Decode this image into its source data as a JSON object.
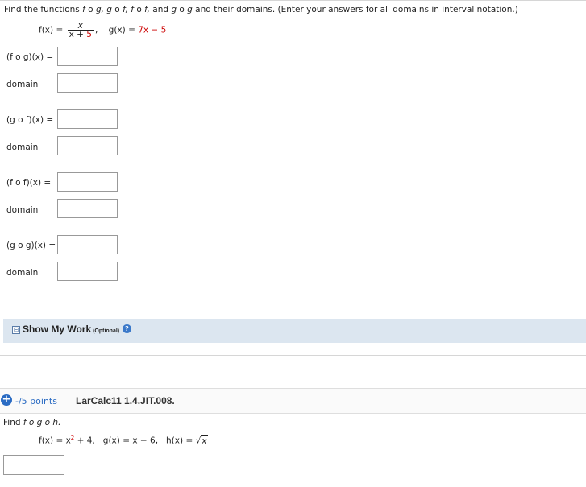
{
  "instructions": {
    "prefix": "Find the functions ",
    "c1": "f",
    "o1": " o ",
    "c2": "g,",
    "sp1": " ",
    "c3": "g",
    "o2": " o ",
    "c4": "f,",
    "sp2": " ",
    "c5": "f",
    "o3": " o ",
    "c6": "f,",
    "and": " and ",
    "c7": "g",
    "o4": " o ",
    "c8": "g",
    "suffix": " and their domains. (Enter your answers for all domains in interval notation.)"
  },
  "given": {
    "f_label": "f(x) = ",
    "f_num": "x",
    "f_den_pre": "x + ",
    "f_den_red": "5",
    "comma": ",",
    "g_label": "g(x) = ",
    "g_expr": "7x − 5"
  },
  "rows": [
    {
      "label": "(f o g)(x) =",
      "value": ""
    },
    {
      "label": "domain",
      "value": ""
    },
    {
      "label": "(g o f)(x) =",
      "value": ""
    },
    {
      "label": "domain",
      "value": ""
    },
    {
      "label": "(f o f)(x) =",
      "value": ""
    },
    {
      "label": "domain",
      "value": ""
    },
    {
      "label": "(g o g)(x) =",
      "value": ""
    },
    {
      "label": "domain",
      "value": ""
    }
  ],
  "show_my_work": {
    "icon": "⊟",
    "title": "Show My Work",
    "optional": " (Optional)",
    "help": "?"
  },
  "question2": {
    "plus": "+",
    "points": "-/5 points",
    "id": "LarCalc11 1.4.JIT.008.",
    "find_prefix": "Find ",
    "find_expr": "f o g o h.",
    "f": "f(x) = x",
    "f_exp": "2",
    "f_rest": " + 4,",
    "g": "g(x) = x − 6,",
    "h": "h(x) = ",
    "sqrt_sym": "√",
    "sqrt_arg": "x",
    "answer": ""
  }
}
